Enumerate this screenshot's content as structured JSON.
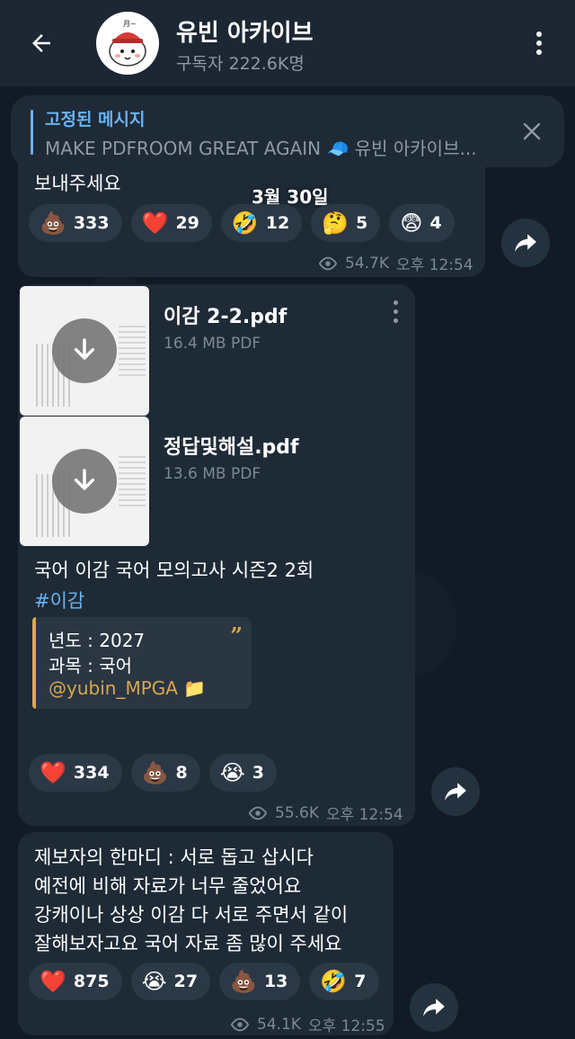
{
  "header": {
    "title": "유빈 아카이브",
    "subtitle": "구독자 222.6K명",
    "icons": {
      "back": "back-arrow-icon",
      "menu": "more-vert-icon"
    }
  },
  "pinned": {
    "label": "고정된 메시지",
    "text": "MAKE PDFROOM GREAT AGAIN 🧢 유빈 아카이브..."
  },
  "date_chip": "3월 30일",
  "messages": [
    {
      "text": "보내주세요",
      "reactions": [
        {
          "emoji": "💩",
          "count": "333"
        },
        {
          "emoji": "❤️",
          "count": "29"
        },
        {
          "emoji": "🤣",
          "count": "12"
        },
        {
          "emoji": "🤔",
          "count": "5"
        },
        {
          "emoji": "😨",
          "count": "4"
        }
      ],
      "views": "54.7K",
      "time": "오후 12:54"
    },
    {
      "files": [
        {
          "name": "이감 2-2.pdf",
          "size": "16.4 MB PDF"
        },
        {
          "name": "정답및해설.pdf",
          "size": "13.6 MB PDF"
        }
      ],
      "caption": "국어 이감 국어 모의고사 시즌2 2회",
      "hashtag": "#이감",
      "quote": {
        "line1": "년도 : 2027",
        "line2": "과목 : 국어",
        "link": "@yubin_MPGA",
        "link_emoji": "📁"
      },
      "reactions": [
        {
          "emoji": "❤️",
          "count": "334"
        },
        {
          "emoji": "💩",
          "count": "8"
        },
        {
          "emoji": "😭",
          "count": "3"
        }
      ],
      "views": "55.6K",
      "time": "오후 12:54"
    },
    {
      "lines": [
        "제보자의 한마디 : 서로 돕고 삽시다",
        "예전에 비해 자료가 너무 줄었어요",
        "강캐이나 상상 이감 다 서로 주면서 같이",
        "잘해보자고요 국어 자료 좀 많이 주세요"
      ],
      "reactions": [
        {
          "emoji": "❤️",
          "count": "875"
        },
        {
          "emoji": "😭",
          "count": "27"
        },
        {
          "emoji": "💩",
          "count": "13"
        },
        {
          "emoji": "🤣",
          "count": "7"
        }
      ],
      "views": "54.1K",
      "time": "오후 12:55"
    }
  ],
  "colors": {
    "accent": "#6ab3f3",
    "quote_accent": "#d9a64e",
    "bubble": "#1e2a36",
    "header": "#1c2733"
  }
}
